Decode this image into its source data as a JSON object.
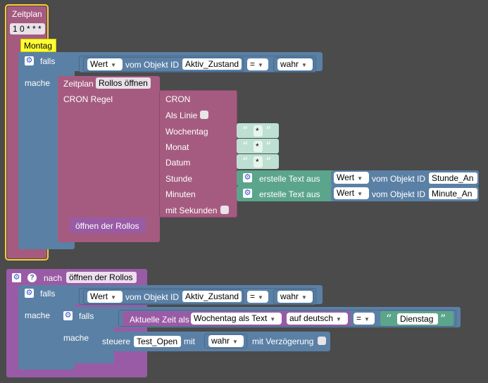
{
  "schedule_block": {
    "title": "Zeitplan",
    "cron": "1 0 * * *",
    "comment": "Montag",
    "if_label": "falls",
    "if_value_dd": "Wert",
    "if_object_label": "vom Objekt ID",
    "if_object_id": "Aktiv_Zustand",
    "if_operator": "=",
    "if_bool": "wahr",
    "do_label": "mache",
    "inner_schedule": {
      "title": "Zeitplan",
      "name": "Rollos öffnen",
      "cron_rule_label": "CRON Regel",
      "cron_label": "CRON",
      "als_linie_label": "Als Linie",
      "wochentag_label": "Wochentag",
      "monat_label": "Monat",
      "datum_label": "Datum",
      "stunde_label": "Stunde",
      "minuten_label": "Minuten",
      "mit_sekunden_label": "mit Sekunden",
      "wochentag_value": "*",
      "monat_value": "*",
      "datum_value": "*",
      "create_text_label": "erstelle Text aus",
      "stunde_value_dd": "Wert",
      "stunde_object_label": "vom Objekt ID",
      "stunde_object_id": "Stunde_An",
      "minuten_value_dd": "Wert",
      "minuten_object_label": "vom Objekt ID",
      "minuten_object_id": "Minute_An",
      "call_label": "öffnen der Rollos"
    }
  },
  "function_block": {
    "prefix": "nach",
    "name": "öffnen der Rollos",
    "if_label": "falls",
    "if_value_dd": "Wert",
    "if_object_label": "vom Objekt ID",
    "if_object_id": "Aktiv_Zustand",
    "if_operator": "=",
    "if_bool": "wahr",
    "do_label": "mache",
    "inner_if_label": "falls",
    "time_label": "Aktuelle Zeit als",
    "time_format": "Wochentag als Text",
    "time_lang": "auf deutsch",
    "inner_operator": "=",
    "day_value": "Dienstag",
    "inner_do_label": "mache",
    "control_label": "steuere",
    "control_object": "Test_Open",
    "with_label": "mit",
    "control_value": "wahr",
    "delay_label": "mit Verzögerung"
  },
  "colors": {
    "schedule": "#a55b80",
    "control": "#5b80a5",
    "text": "#5ba58c",
    "function": "#995ba5",
    "comment": "#ffff00",
    "highlight": "#fc3"
  }
}
